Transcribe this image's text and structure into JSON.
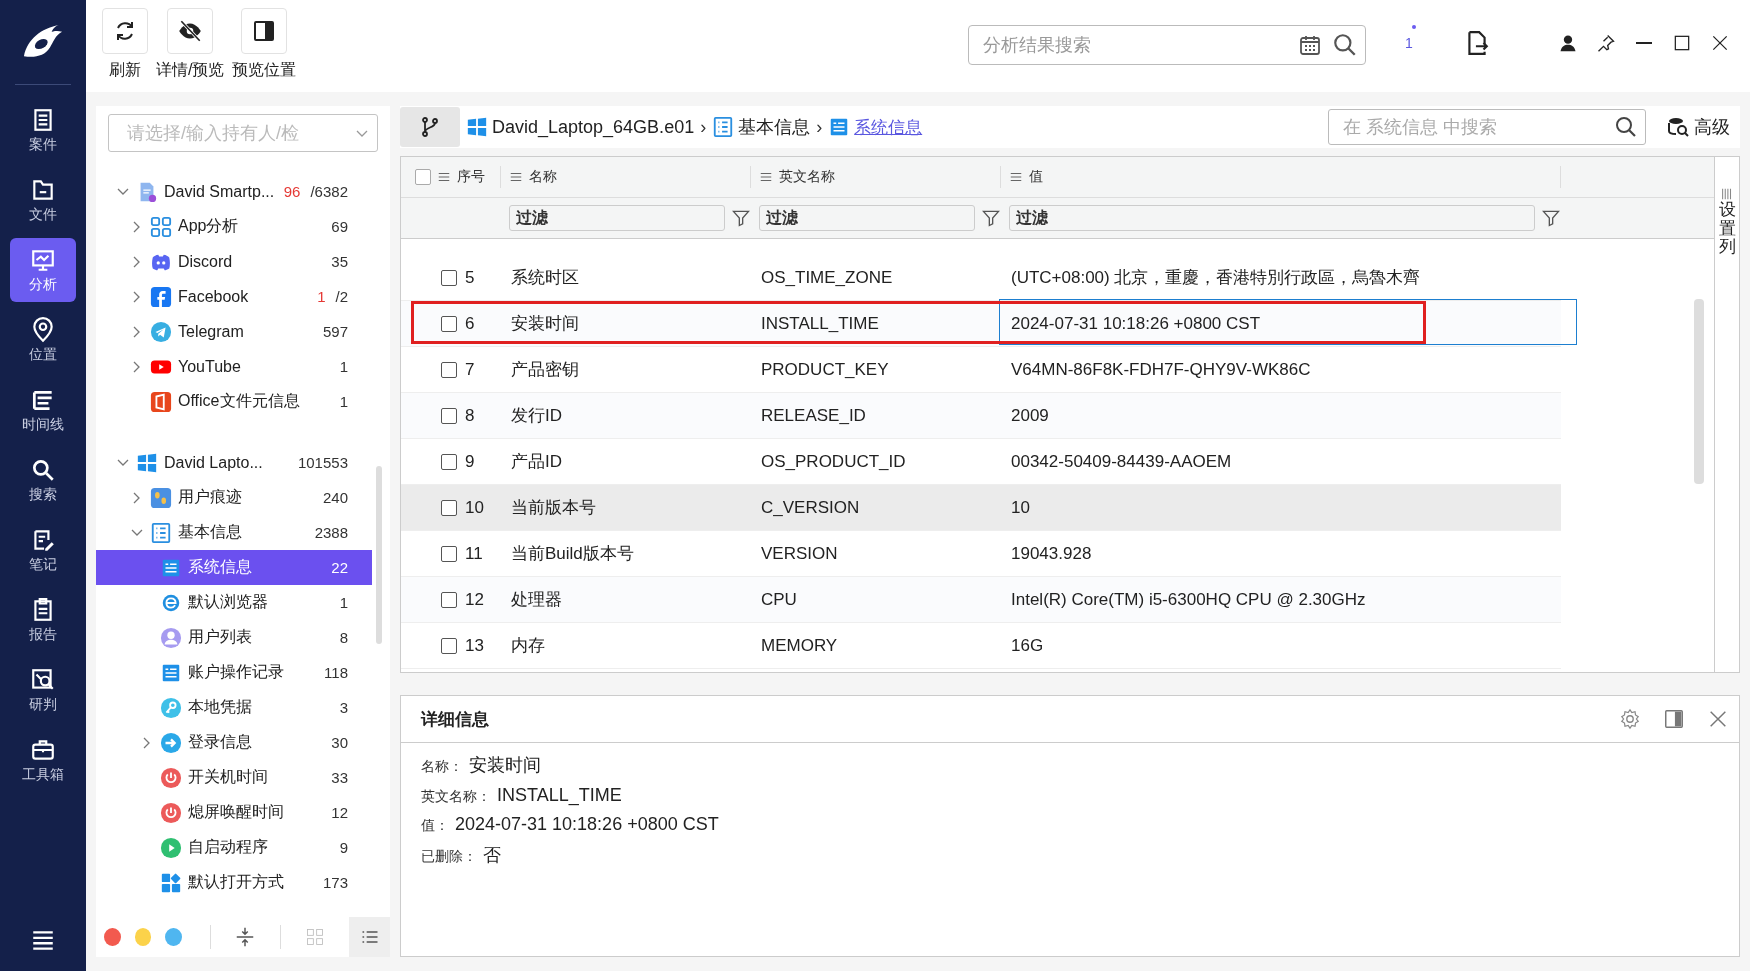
{
  "toolbar": [
    {
      "kind": "refresh",
      "label": "刷新"
    },
    {
      "kind": "preview",
      "label": "详情/预览"
    },
    {
      "kind": "position",
      "label": "预览位置"
    }
  ],
  "search": {
    "placeholder": "分析结果搜索"
  },
  "badge": "1",
  "nav": [
    {
      "kind": "case",
      "label": "案件",
      "selected": false
    },
    {
      "kind": "file",
      "label": "文件",
      "selected": false
    },
    {
      "kind": "analysis",
      "label": "分析",
      "selected": true
    },
    {
      "kind": "location",
      "label": "位置",
      "selected": false
    },
    {
      "kind": "timeline",
      "label": "时间线",
      "selected": false
    },
    {
      "kind": "search",
      "label": "搜索",
      "selected": false
    },
    {
      "kind": "note",
      "label": "笔记",
      "selected": false
    },
    {
      "kind": "report",
      "label": "报告",
      "selected": false
    },
    {
      "kind": "judge",
      "label": "研判",
      "selected": false
    },
    {
      "kind": "toolbox",
      "label": "工具箱",
      "selected": false
    }
  ],
  "owner_select": {
    "placeholder": "请选择/输入持有人/检"
  },
  "tree": [
    {
      "kind": "phone",
      "name": "David Smartp...",
      "flag": "96",
      "count": "/6382",
      "expanded": true,
      "selected": false,
      "children": [
        {
          "kind": "apps",
          "name": "App分析",
          "count": "69",
          "expanded": false,
          "selected": false
        },
        {
          "kind": "discord",
          "name": "Discord",
          "count": "35",
          "expanded": false,
          "selected": false
        },
        {
          "kind": "facebook",
          "name": "Facebook",
          "flag": "1",
          "count": "/2",
          "expanded": false,
          "selected": false
        },
        {
          "kind": "telegram",
          "name": "Telegram",
          "count": "597",
          "expanded": false,
          "selected": false
        },
        {
          "kind": "youtube",
          "name": "YouTube",
          "count": "1",
          "expanded": false,
          "selected": false
        },
        {
          "kind": "office",
          "name": "Office文件元信息",
          "count": "1",
          "selected": false
        }
      ]
    },
    {
      "kind": "windows",
      "name": "David Lapto...",
      "count": "101553",
      "expanded": true,
      "selected": false,
      "children": [
        {
          "kind": "footprint",
          "name": "用户痕迹",
          "count": "240",
          "expanded": false,
          "selected": false
        },
        {
          "kind": "list",
          "name": "基本信息",
          "count": "2388",
          "expanded": true,
          "selected": false,
          "children": [
            {
              "kind": "card",
              "name": "系统信息",
              "count": "22",
              "selected": true
            },
            {
              "kind": "browser",
              "name": "默认浏览器",
              "count": "1",
              "selected": false
            },
            {
              "kind": "user",
              "name": "用户列表",
              "count": "8",
              "selected": false
            },
            {
              "kind": "card",
              "name": "账户操作记录",
              "count": "118",
              "selected": false
            },
            {
              "kind": "key",
              "name": "本地凭据",
              "count": "3",
              "selected": false
            },
            {
              "kind": "login",
              "name": "登录信息",
              "count": "30",
              "expanded": false,
              "selected": false
            },
            {
              "kind": "power",
              "name": "开关机时间",
              "count": "33",
              "selected": false
            },
            {
              "kind": "power",
              "name": "熄屏唤醒时间",
              "count": "12",
              "selected": false
            },
            {
              "kind": "play",
              "name": "自启动程序",
              "count": "9",
              "selected": false
            },
            {
              "kind": "tiles",
              "name": "默认打开方式",
              "count": "173",
              "selected": false
            }
          ]
        }
      ]
    }
  ],
  "color_dots": [
    {
      "color": "#f25a4f"
    },
    {
      "color": "#fbd24a"
    },
    {
      "color": "#4fb6f0"
    }
  ],
  "view_buttons": [
    {
      "kind": "grid",
      "selected": false
    },
    {
      "kind": "list",
      "selected": true
    }
  ],
  "breadcrumb": [
    {
      "kind": "windows",
      "label": "David_Laptop_64GB.e01",
      "selected": false
    },
    {
      "kind": "list",
      "label": "基本信息",
      "selected": false
    },
    {
      "kind": "card",
      "label": "系统信息",
      "selected": true
    }
  ],
  "breadcrumb_separator": "›",
  "table_search": {
    "placeholder": "在 系统信息 中搜索"
  },
  "advanced": "高级",
  "table": {
    "all_checked": false,
    "columns": [
      {
        "label": "序号"
      },
      {
        "label": "名称",
        "placeholder": "过滤"
      },
      {
        "label": "英文名称",
        "placeholder": "过滤"
      },
      {
        "label": "值",
        "placeholder": "过滤"
      }
    ],
    "rows": [
      {
        "index": "5",
        "name": "系统时区",
        "english": "OS_TIME_ZONE",
        "value": "(UTC+08:00) 北京，重慶，香港特別行政區，烏魯木齊",
        "checked": false,
        "selected": false,
        "hovered": false
      },
      {
        "index": "6",
        "name": "安装时间",
        "english": "INSTALL_TIME",
        "value": "2024-07-31 10:18:26 +0800 CST",
        "checked": false,
        "selected": true,
        "hovered": false
      },
      {
        "index": "7",
        "name": "产品密钥",
        "english": "PRODUCT_KEY",
        "value": "V64MN-86F8K-FDH7F-QHY9V-WK86C",
        "checked": false,
        "selected": false,
        "hovered": false
      },
      {
        "index": "8",
        "name": "发行ID",
        "english": "RELEASE_ID",
        "value": "2009",
        "checked": false,
        "selected": false,
        "hovered": false
      },
      {
        "index": "9",
        "name": "产品ID",
        "english": "OS_PRODUCT_ID",
        "value": "00342-50409-84439-AAOEM",
        "checked": false,
        "selected": false,
        "hovered": false
      },
      {
        "index": "10",
        "name": "当前版本号",
        "english": "C_VERSION",
        "value": "10",
        "checked": false,
        "selected": false,
        "hovered": true
      },
      {
        "index": "11",
        "name": "当前Build版本号",
        "english": "VERSION",
        "value": "19043.928",
        "checked": false,
        "selected": false,
        "hovered": false
      },
      {
        "index": "12",
        "name": "处理器",
        "english": "CPU",
        "value": "Intel(R) Core(TM) i5-6300HQ CPU @ 2.30GHz",
        "checked": false,
        "selected": false,
        "hovered": false
      },
      {
        "index": "13",
        "name": "内存",
        "english": "MEMORY",
        "value": "16G",
        "checked": false,
        "selected": false,
        "hovered": false
      }
    ]
  },
  "column_settings": "设置列",
  "detail": {
    "title": "详细信息",
    "fields": [
      {
        "label": "名称：",
        "value": "安装时间"
      },
      {
        "label": "英文名称：",
        "value": "INSTALL_TIME"
      },
      {
        "label": "值：",
        "value": "2024-07-31 10:18:26 +0800 CST"
      },
      {
        "label": "已删除：",
        "value": "否"
      }
    ]
  }
}
